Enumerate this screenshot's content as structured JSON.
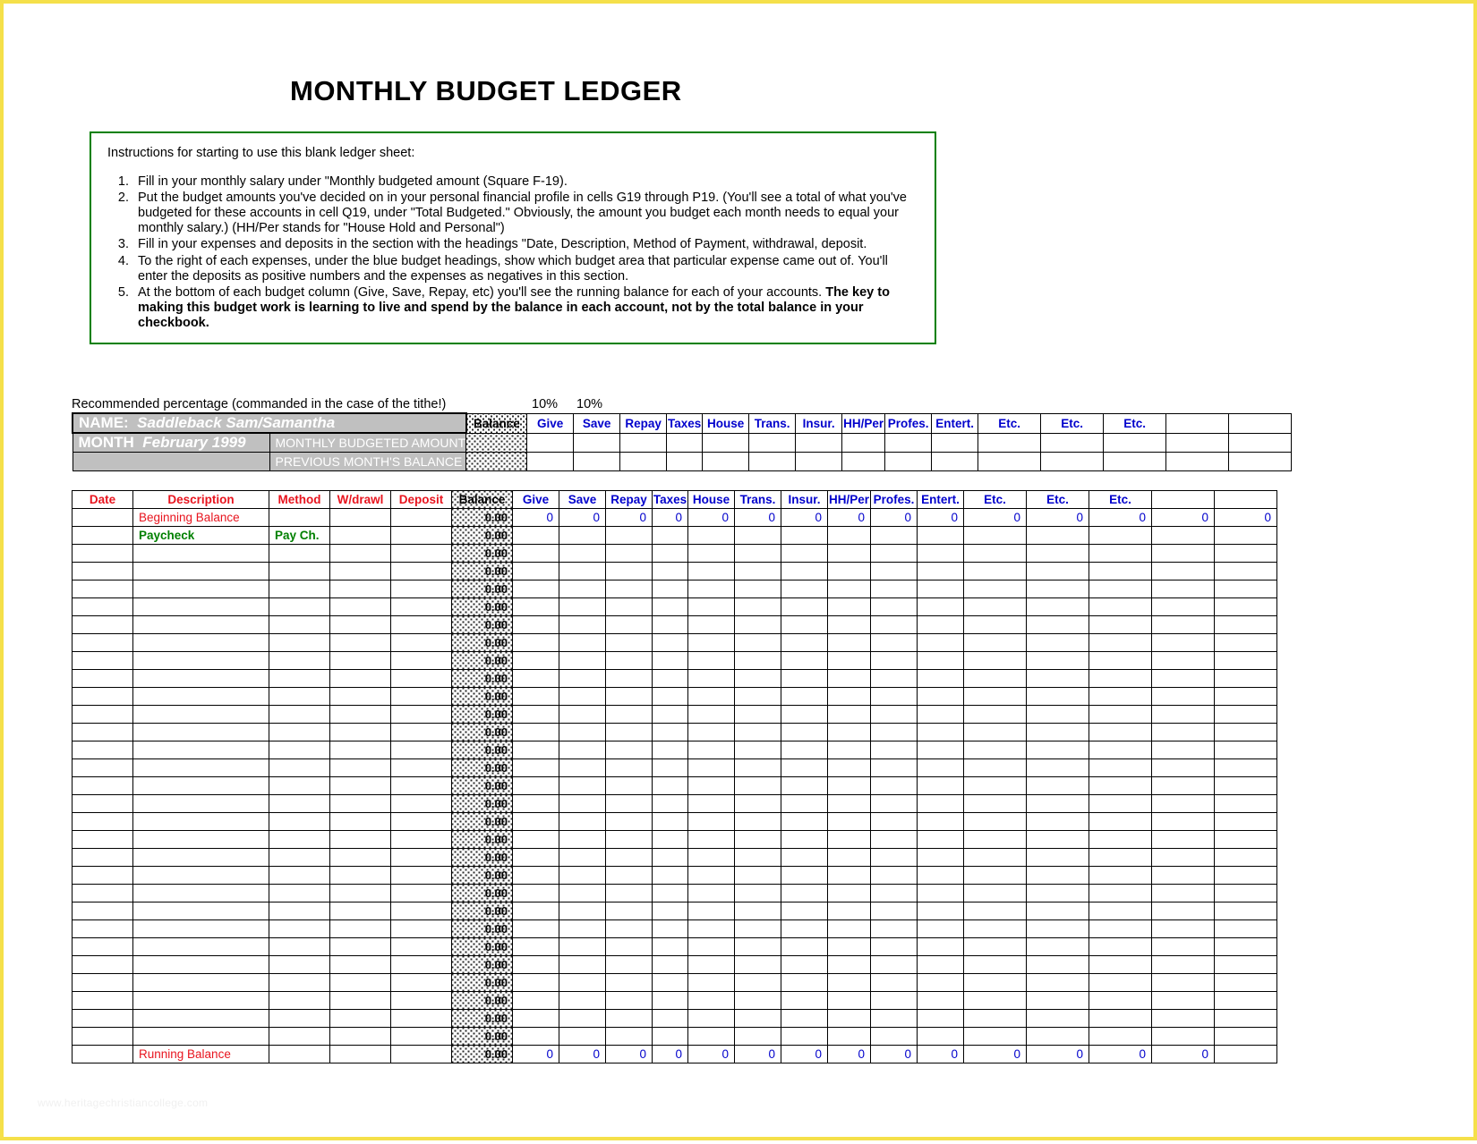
{
  "page": {
    "title": "MONTHLY BUDGET LEDGER",
    "watermark": "www.heritagechristiancollege.com",
    "accent_green": "#008000",
    "accent_red": "#e8141e",
    "accent_blue": "#0000cc",
    "gray_fill": "#c0c0c0",
    "border_yellow": "#f5e04a"
  },
  "instructions": {
    "lead": "Instructions for starting to use this blank ledger sheet:",
    "items": [
      "Fill in your monthly salary under \"Monthly budgeted amount (Square F-19).",
      "Put the budget amounts you've decided on in your personal financial profile in cells G19 through P19.  (You'll see a total of what you've budgeted for these accounts in cell Q19, under \"Total Budgeted.\"  Obviously, the amount you budget each month needs to equal your monthly salary.)      (HH/Per stands for \"House Hold and Personal\")",
      "Fill in your expenses and deposits in the section with the headings \"Date, Description, Method of Payment, withdrawal, deposit.",
      "To the right of each expenses, under the blue budget headings, show which budget area that particular expense came out of.  You'll enter the deposits as positive numbers and the expenses as negatives in this section.",
      "At the bottom of each budget column (Give, Save, Repay, etc) you'll see the running balance for each of your accounts.  "
    ],
    "item5_bold": "The key to making this budget work is learning to live and spend by the balance in each account, not by the total balance in your checkbook."
  },
  "recommended": {
    "label": "Recommended percentage (commanded in the case of the tithe!)",
    "give_pct": "10%",
    "save_pct": "10%"
  },
  "identity": {
    "name_label": "NAME:",
    "name_value": "Saddleback Sam/Samantha",
    "month_label": "MONTH",
    "month_value": "February 1999",
    "monthly_budgeted_caption": "MONTHLY BUDGETED AMOUNT",
    "previous_balance_caption": "PREVIOUS MONTH'S BALANCE"
  },
  "budget_columns": {
    "balance_header": "Balance",
    "headers": [
      "Give",
      "Save",
      "Repay",
      "Taxes",
      "House",
      "Trans.",
      "Insur.",
      "HH/Per",
      "Profes.",
      "Entert.",
      "Etc.",
      "Etc.",
      "Etc.",
      "",
      ""
    ]
  },
  "ledger": {
    "headers": [
      "Date",
      "Description",
      "Method",
      "W/drawl",
      "Deposit",
      "Balance"
    ],
    "rows": [
      {
        "date": "",
        "description": "Beginning Balance",
        "desc_style": "red",
        "method": "",
        "method_style": "red",
        "wdrawl": "",
        "deposit": "",
        "balance": "0.00",
        "budget_values": [
          "0",
          "0",
          "0",
          "0",
          "0",
          "0",
          "0",
          "0",
          "0",
          "0",
          "0",
          "0",
          "0",
          "0",
          "0"
        ]
      },
      {
        "date": "",
        "description": "Paycheck",
        "desc_style": "green",
        "method": "Pay Ch.",
        "method_style": "green",
        "wdrawl": "",
        "deposit": "",
        "balance": "0.00",
        "budget_values": [
          "",
          "",
          "",
          "",
          "",
          "",
          "",
          "",
          "",
          "",
          "",
          "",
          "",
          "",
          ""
        ]
      }
    ],
    "blank_row_count": 28,
    "blank_row_balance": "0.00",
    "total_row": {
      "date": "",
      "description": "Running Balance",
      "desc_style": "red",
      "method": "",
      "wdrawl": "",
      "deposit": "",
      "balance": "0.00",
      "budget_values": [
        "0",
        "0",
        "0",
        "0",
        "0",
        "0",
        "0",
        "0",
        "0",
        "0",
        "0",
        "0",
        "0",
        "0",
        ""
      ]
    }
  }
}
